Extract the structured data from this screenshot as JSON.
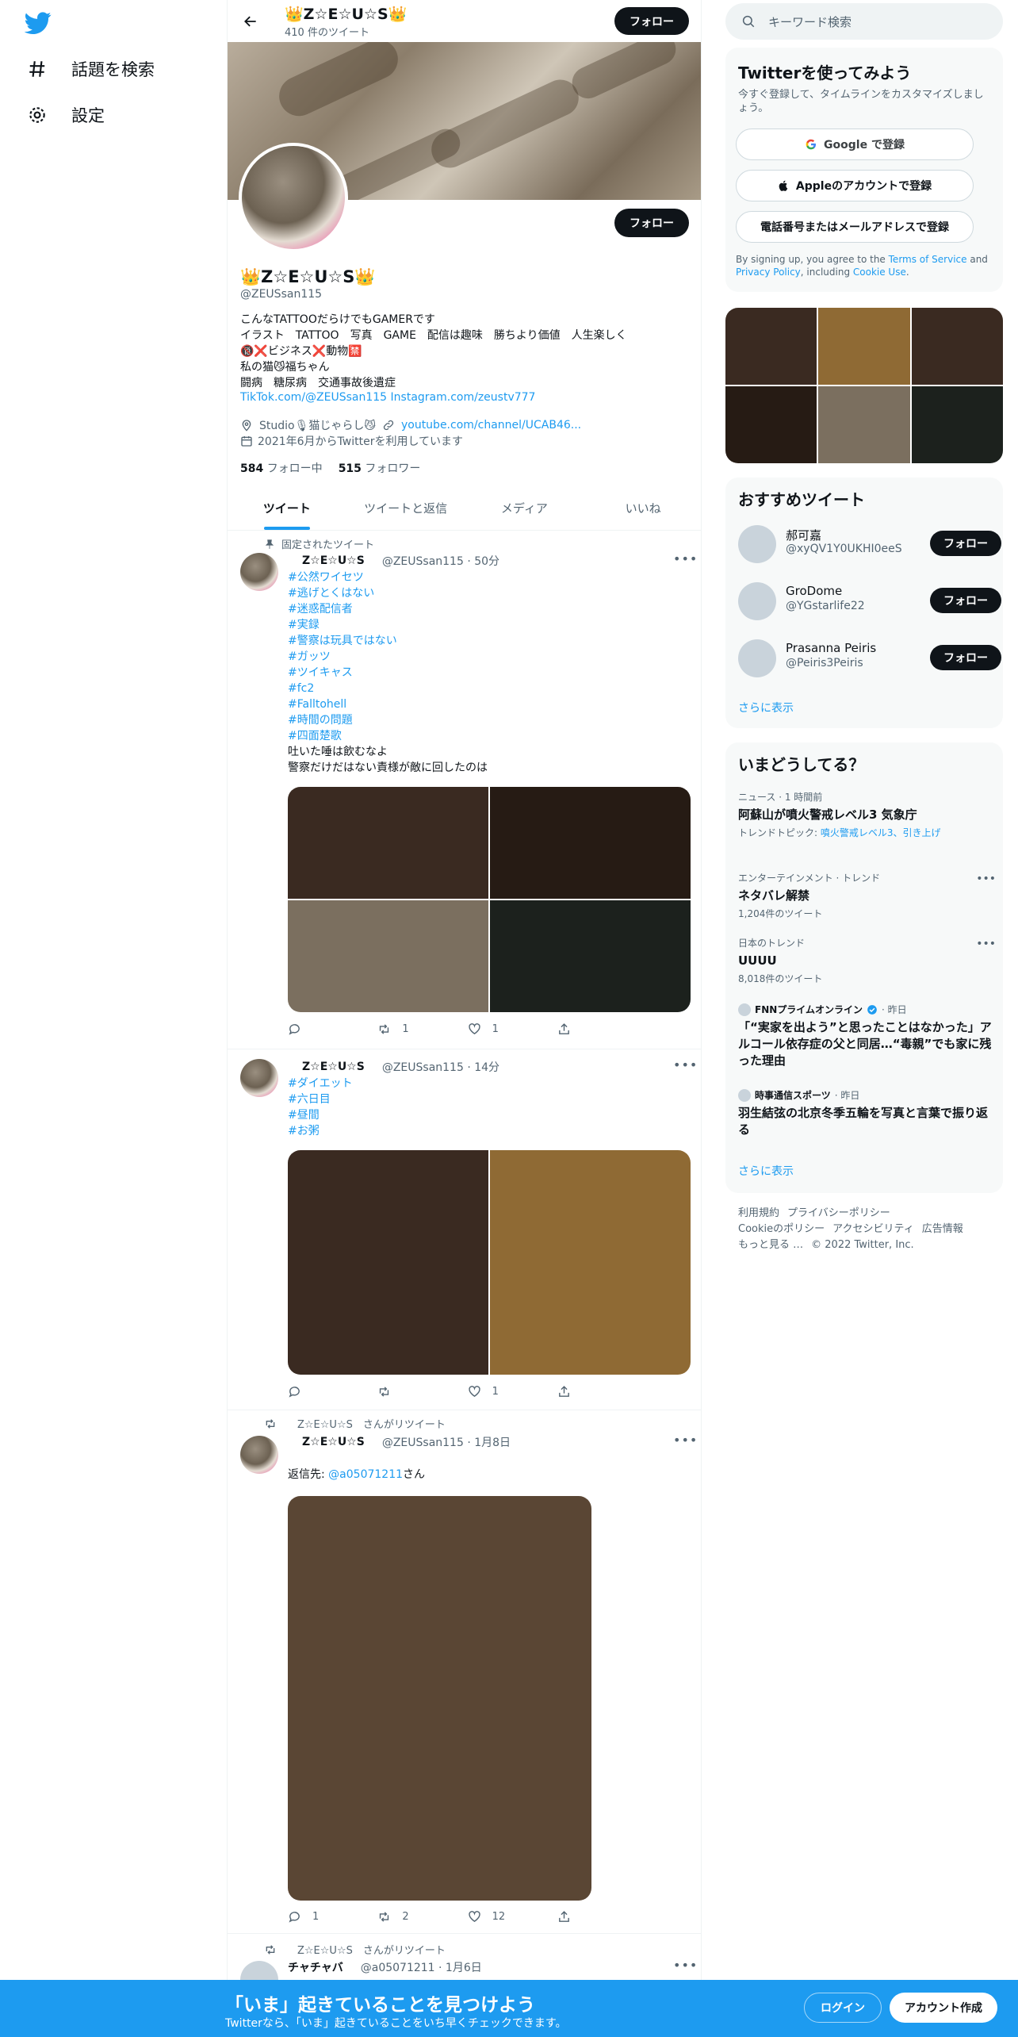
{
  "sidebar": {
    "logo_icon": "twitter-bird-icon",
    "items": [
      {
        "label": "話題を検索",
        "icon": "hashtag-icon"
      },
      {
        "label": "設定",
        "icon": "gear-icon"
      }
    ]
  },
  "header": {
    "name": "👑Z☆E☆U☆S👑",
    "tweet_count": "410 件のツイート",
    "follow_label": "フォロー"
  },
  "profile": {
    "follow_label": "フォロー",
    "name": "👑Z☆E☆U☆S👑",
    "handle": "@ZEUSsan115",
    "bio": "こんなTATTOOだらけでもGAMERです\nイラスト　TATTOO　写真　GAME　配信は趣味　勝ちより価値　人生楽しく\n🔞❌ビジネス❌動物🈲\n私の猫😼福ちゃん\n闘病　糖尿病　交通事故後遺症",
    "link1": "TikTok.com/@ZEUSsan115",
    "link2": "Instagram.com/zeustv777",
    "location": "Studio🎙猫じゃらし😼",
    "website": "youtube.com/channel/UCAB46...",
    "joined": "2021年6月からTwitterを利用しています",
    "following_count": "584",
    "following_label": "フォロー中",
    "followers_count": "515",
    "followers_label": "フォロワー"
  },
  "tabs": [
    "ツイート",
    "ツイートと返信",
    "メディア",
    "いいね"
  ],
  "tweets": [
    {
      "context": "固定されたツイート",
      "name": "Z☆E☆U☆S",
      "handle_time": "@ZEUSsan115 · 50分",
      "hashtags": "#公然ワイセツ\n#逃げとくはない\n#迷惑配信者\n#実録\n#警察は玩具ではない\n#ガッツ\n#ツイキャス\n#fc2\n#Falltohell\n#時間の問題\n#四面楚歌",
      "text": "吐いた唾は飲むなよ\n警察だけだはない責様が敵に回したのは",
      "media_colors": [
        "#3a2a21",
        "#261b14",
        "#7b6f5f",
        "#1c211d"
      ],
      "reply": "",
      "retweet": "1",
      "like": "1"
    },
    {
      "name": "Z☆E☆U☆S",
      "handle_time": "@ZEUSsan115 · 14分",
      "hashtags": "#ダイエット\n#六日目\n#昼間\n#お粥",
      "media_colors": [
        "#3a2a21",
        "#8f6a34"
      ],
      "reply": "",
      "retweet": "",
      "like": "1"
    },
    {
      "context": "Z☆E☆U☆S　さんがリツイート",
      "name": "Z☆E☆U☆S",
      "handle_time": "@ZEUSsan115 · 1月8日",
      "reply_prefix": "返信先: ",
      "reply_to": "@a05071211",
      "reply_suffix": "さん",
      "media_colors": [
        "#5a4634"
      ],
      "reply": "1",
      "retweet": "2",
      "like": "12"
    },
    {
      "context": "Z☆E☆U☆S　さんがリツイート",
      "name": "チャチャバ",
      "handle_time": "@a05071211 · 1月6日"
    }
  ],
  "right": {
    "search_placeholder": "キーワード検索",
    "signup": {
      "title": "Twitterを使ってみよう",
      "subtitle": "今すぐ登録して、タイムラインをカスタマイズしましょう。",
      "google": "Google で登録",
      "apple": "Appleのアカウントで登録",
      "phone": "電話番号またはメールアドレスで登録",
      "terms_prefix": "By signing up, you agree to the ",
      "terms_link": "Terms of Service",
      "terms_and": " and ",
      "privacy_link": "Privacy Policy",
      "terms_including": ", including ",
      "cookie_link": "Cookie Use",
      "terms_end": "."
    },
    "photo_colors": [
      "#3a2a21",
      "#8f6a34",
      "#3a2a21",
      "#261b14",
      "#7b6f5f",
      "#1c211d"
    ],
    "recs": {
      "title": "おすすめツイート",
      "accounts": [
        {
          "name": "郝可嘉",
          "handle": "@xyQV1Y0UKHI0eeS",
          "follow": "フォロー"
        },
        {
          "name": "GroDome",
          "handle": "@YGstarlife22",
          "follow": "フォロー"
        },
        {
          "name": "Prasanna Peiris",
          "handle": "@Peiris3Peiris",
          "follow": "フォロー"
        }
      ],
      "more": "さらに表示"
    },
    "trends": {
      "title": "いまどうしてる？",
      "items": [
        {
          "meta": "ニュース · 1 時間前",
          "title": "阿蘇山が噴火警戒レベル3 気象庁",
          "sub_prefix": "トレンドトピック: ",
          "sub_link": "噴火警戒レベル3、引き上げ"
        },
        {
          "meta": "エンターテインメント · トレンド",
          "title": "ネタバレ解禁",
          "sub": "1,204件のツイート"
        },
        {
          "meta": "日本のトレンド",
          "title": "UUUU",
          "sub": "8,018件のツイート"
        }
      ],
      "news": [
        {
          "source": "FNNプライムオンライン",
          "time": "· 昨日",
          "title": "「“実家を出よう”と思ったことはなかった」アルコール依存症の父と同居…“毒親”でも家に残った理由"
        },
        {
          "source": "時事通信スポーツ",
          "time": "· 昨日",
          "title": "羽生結弦の北京冬季五輪を写真と言葉で振り返る"
        }
      ],
      "more": "さらに表示"
    },
    "footer": [
      "利用規約",
      "プライバシーポリシー",
      "Cookieのポリシー",
      "アクセシビリティ",
      "広告情報",
      "もっと見る …",
      "© 2022 Twitter, Inc."
    ]
  },
  "bottombar": {
    "title": "「いま」起きていることを見つけよう",
    "subtitle": "Twitterなら、「いま」起きていることをいち早くチェックできます。",
    "login": "ログイン",
    "signup": "アカウント作成"
  },
  "colors": {
    "accent": "#1d9bf0",
    "dark_button": "#0f1419",
    "muted": "#536471"
  }
}
